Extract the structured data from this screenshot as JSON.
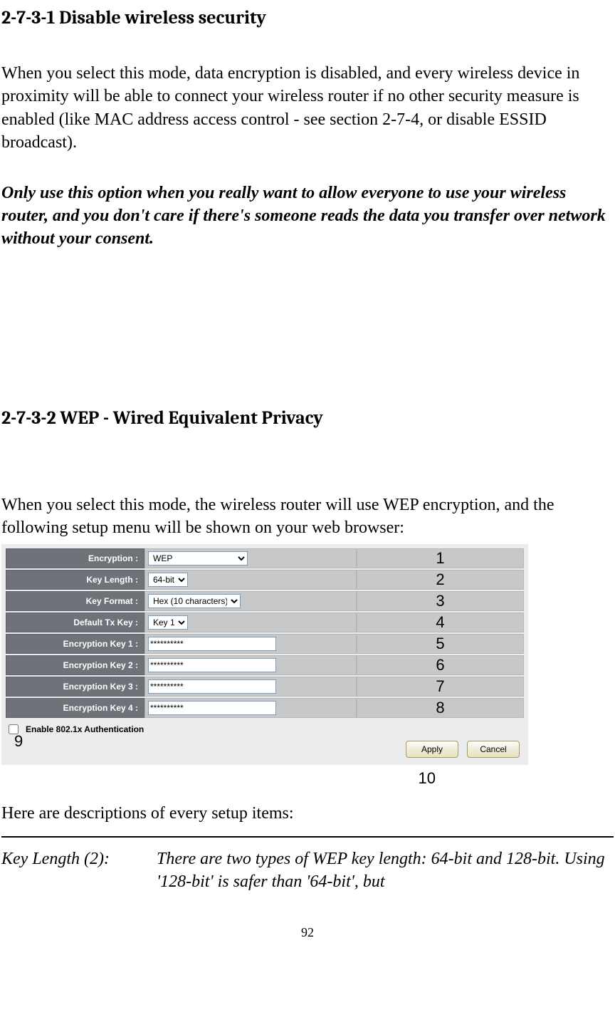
{
  "section1": {
    "heading": "2-7-3-1 Disable wireless security",
    "para": "When you select this mode, data encryption is disabled, and every wireless device in proximity will be able to connect your wireless router if no other security measure is enabled (like MAC address access control - see section 2-7-4, or disable ESSID broadcast).",
    "warning": "Only use this option when you really want to allow everyone to use your wireless router, and you don't care if there's someone reads the data you transfer over network without your consent."
  },
  "section2": {
    "heading": "2-7-3-2 WEP - Wired Equivalent Privacy",
    "intro": "When you select this mode, the wireless router will use WEP encryption, and the following setup menu will be shown on your web browser:"
  },
  "form": {
    "rows": [
      {
        "label": "Encryption :",
        "type": "select",
        "value": "WEP",
        "cls": "sel-encryption",
        "num": "1"
      },
      {
        "label": "Key Length :",
        "type": "select",
        "value": "64-bit",
        "cls": "sel-keylen",
        "num": "2"
      },
      {
        "label": "Key Format :",
        "type": "select",
        "value": "Hex (10 characters)",
        "cls": "sel-keyfmt",
        "num": "3"
      },
      {
        "label": "Default Tx Key :",
        "type": "select",
        "value": "Key 1",
        "cls": "sel-txkey",
        "num": "4"
      },
      {
        "label": "Encryption Key 1 :",
        "type": "password",
        "value": "**********",
        "cls": "inp-key",
        "num": "5"
      },
      {
        "label": "Encryption Key 2 :",
        "type": "password",
        "value": "**********",
        "cls": "inp-key",
        "num": "6"
      },
      {
        "label": "Encryption Key 3 :",
        "type": "password",
        "value": "**********",
        "cls": "inp-key",
        "num": "7"
      },
      {
        "label": "Encryption Key 4 :",
        "type": "password",
        "value": "**********",
        "cls": "inp-key",
        "num": "8"
      }
    ],
    "auth_label": "Enable 802.1x Authentication",
    "apply": "Apply",
    "cancel": "Cancel",
    "marker9": "9",
    "marker10": "10"
  },
  "descriptions": {
    "heading": "Here are descriptions of every setup items:",
    "item": {
      "term": "Key Length (2):",
      "def": "There are two types of WEP key length: 64-bit and 128-bit. Using '128-bit' is safer than '64-bit', but"
    }
  },
  "page_number": "92"
}
